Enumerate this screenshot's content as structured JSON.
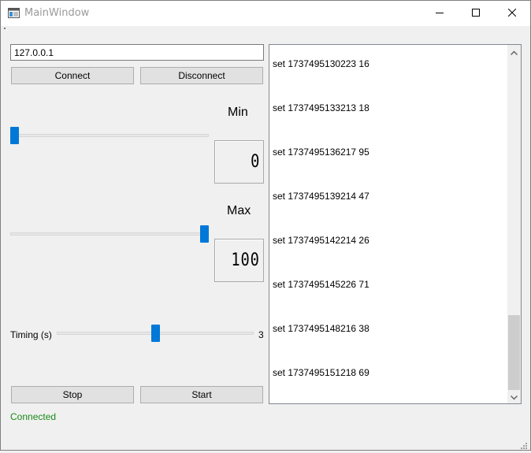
{
  "window": {
    "title": "MainWindow"
  },
  "icons": {
    "app": "app-window-icon",
    "minimize": "minimize-icon",
    "maximize": "maximize-icon",
    "close": "close-icon"
  },
  "connection": {
    "ip_value": "127.0.0.1",
    "connect_label": "Connect",
    "disconnect_label": "Disconnect"
  },
  "min_control": {
    "label": "Min",
    "value": 0,
    "value_text": "0",
    "slider_fraction": 0.0
  },
  "max_control": {
    "label": "Max",
    "value": 100,
    "value_text": "100",
    "slider_fraction": 1.0
  },
  "timing": {
    "label": "Timing (s)",
    "value_text": "3",
    "slider_fraction": 0.5
  },
  "actions": {
    "stop_label": "Stop",
    "start_label": "Start"
  },
  "status": {
    "text": "Connected",
    "color": "#1a8a1a"
  },
  "log": {
    "items": [
      "set 1737495130223 16",
      "set 1737495133213 18",
      "set 1737495136217 95",
      "set 1737495139214 47",
      "set 1737495142214 26",
      "set 1737495145226 71",
      "set 1737495148216 38",
      "set 1737495151218 69"
    ]
  },
  "colors": {
    "accent": "#0078d7",
    "button_bg": "#e1e1e1",
    "window_bg": "#f0f0f0"
  }
}
